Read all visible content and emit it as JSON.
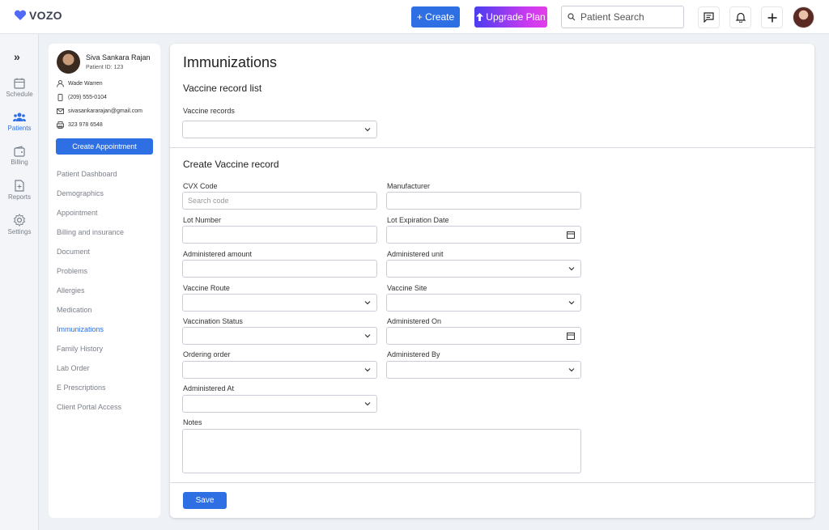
{
  "app": {
    "name": "VOZO"
  },
  "header": {
    "create_label": "+ Create",
    "upgrade_label": "Upgrade Plan",
    "search_placeholder": "Patient Search"
  },
  "leftnav": {
    "items": [
      {
        "label": "Schedule",
        "icon": "calendar-icon"
      },
      {
        "label": "Patients",
        "icon": "users-icon"
      },
      {
        "label": "Billing",
        "icon": "wallet-icon"
      },
      {
        "label": "Reports",
        "icon": "report-icon"
      },
      {
        "label": "Settings",
        "icon": "gear-icon"
      }
    ]
  },
  "patient": {
    "name": "Siva Sankara Rajan",
    "id": "Patient ID: 123",
    "contact_name": "Wade Warren",
    "phone": "(209) 555-0104",
    "email": "sivasankararajan@gmail.com",
    "fax": "323 978 6548",
    "create_appointment": "Create Appointment"
  },
  "menu": [
    "Patient Dashboard",
    "Demographics",
    "Appointment",
    "Billing and insurance",
    "Document",
    "Problems",
    "Allergies",
    "Medication",
    "Immunizations",
    "Family History",
    "Lab Order",
    "E Prescriptions",
    "Client Portal Access"
  ],
  "main": {
    "title": "Immunizations",
    "list_heading": "Vaccine record list",
    "records_label": "Vaccine records",
    "create_heading": "Create Vaccine record",
    "fields": {
      "cvx": "CVX Code",
      "cvx_placeholder": "Search code",
      "manufacturer": "Manufacturer",
      "lot": "Lot Number",
      "lot_exp": "Lot Expiration Date",
      "amount": "Administered amount",
      "unit": "Administered unit",
      "route": "Vaccine Route",
      "site": "Vaccine Site",
      "status": "Vaccination Status",
      "admin_on": "Administered On",
      "ordering": "Ordering order",
      "admin_by": "Administered By",
      "admin_at": "Administered At",
      "notes": "Notes"
    },
    "save_label": "Save"
  }
}
